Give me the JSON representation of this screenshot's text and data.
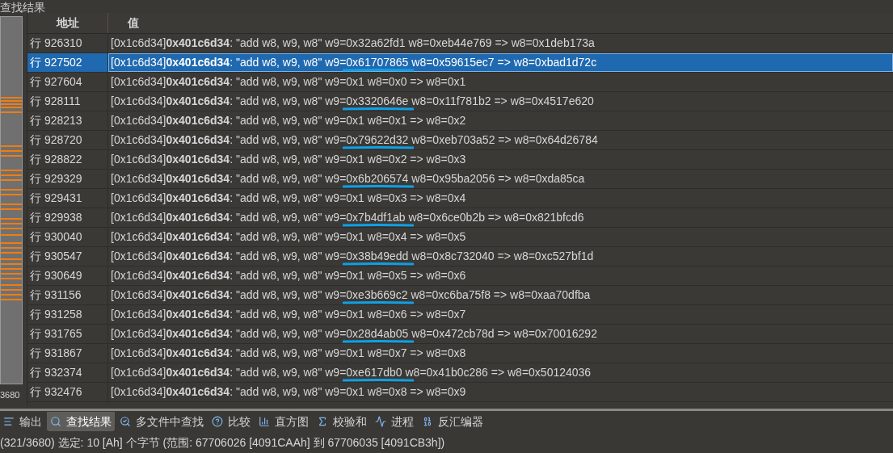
{
  "panel_title": "查找结果",
  "overview_label": "3680",
  "table": {
    "columns": [
      "地址",
      "值"
    ],
    "rows": [
      {
        "address": "行 926310",
        "value": "[0x1c6d34]**0x401c6d34**: \"add w8, w9, w8\" w9=0x32a62fd1 w8=0xeb44e769 => w8=0x1deb173a",
        "selected": false,
        "marked": false
      },
      {
        "address": "行 927502",
        "value": "[0x1c6d34]**0x401c6d34**: \"add w8, w9, w8\" w9=0x61707865 w8=0x59615ec7 => w8=0xbad1d72c",
        "selected": true,
        "marked": true
      },
      {
        "address": "行 927604",
        "value": "[0x1c6d34]**0x401c6d34**: \"add w8, w9, w8\" w9=0x1 w8=0x0 => w8=0x1",
        "selected": false,
        "marked": false
      },
      {
        "address": "行 928111",
        "value": "[0x1c6d34]**0x401c6d34**: \"add w8, w9, w8\" w9=0x3320646e w8=0x11f781b2 => w8=0x4517e620",
        "selected": false,
        "marked": true
      },
      {
        "address": "行 928213",
        "value": "[0x1c6d34]**0x401c6d34**: \"add w8, w9, w8\" w9=0x1 w8=0x1 => w8=0x2",
        "selected": false,
        "marked": false
      },
      {
        "address": "行 928720",
        "value": "[0x1c6d34]**0x401c6d34**: \"add w8, w9, w8\" w9=0x79622d32 w8=0xeb703a52 => w8=0x64d26784",
        "selected": false,
        "marked": true
      },
      {
        "address": "行 928822",
        "value": "[0x1c6d34]**0x401c6d34**: \"add w8, w9, w8\" w9=0x1 w8=0x2 => w8=0x3",
        "selected": false,
        "marked": false
      },
      {
        "address": "行 929329",
        "value": "[0x1c6d34]**0x401c6d34**: \"add w8, w9, w8\" w9=0x6b206574 w8=0x95ba2056 => w8=0xda85ca",
        "selected": false,
        "marked": true
      },
      {
        "address": "行 929431",
        "value": "[0x1c6d34]**0x401c6d34**: \"add w8, w9, w8\" w9=0x1 w8=0x3 => w8=0x4",
        "selected": false,
        "marked": false
      },
      {
        "address": "行 929938",
        "value": "[0x1c6d34]**0x401c6d34**: \"add w8, w9, w8\" w9=0x7b4df1ab w8=0x6ce0b2b => w8=0x821bfcd6",
        "selected": false,
        "marked": true
      },
      {
        "address": "行 930040",
        "value": "[0x1c6d34]**0x401c6d34**: \"add w8, w9, w8\" w9=0x1 w8=0x4 => w8=0x5",
        "selected": false,
        "marked": false
      },
      {
        "address": "行 930547",
        "value": "[0x1c6d34]**0x401c6d34**: \"add w8, w9, w8\" w9=0x38b49edd w8=0x8c732040 => w8=0xc527bf1d",
        "selected": false,
        "marked": true
      },
      {
        "address": "行 930649",
        "value": "[0x1c6d34]**0x401c6d34**: \"add w8, w9, w8\" w9=0x1 w8=0x5 => w8=0x6",
        "selected": false,
        "marked": false
      },
      {
        "address": "行 931156",
        "value": "[0x1c6d34]**0x401c6d34**: \"add w8, w9, w8\" w9=0xe3b669c2 w8=0xc6ba75f8 => w8=0xaa70dfba",
        "selected": false,
        "marked": true
      },
      {
        "address": "行 931258",
        "value": "[0x1c6d34]**0x401c6d34**: \"add w8, w9, w8\" w9=0x1 w8=0x6 => w8=0x7",
        "selected": false,
        "marked": false
      },
      {
        "address": "行 931765",
        "value": "[0x1c6d34]**0x401c6d34**: \"add w8, w9, w8\" w9=0x28d4ab05 w8=0x472cb78d => w8=0x70016292",
        "selected": false,
        "marked": true
      },
      {
        "address": "行 931867",
        "value": "[0x1c6d34]**0x401c6d34**: \"add w8, w9, w8\" w9=0x1 w8=0x7 => w8=0x8",
        "selected": false,
        "marked": false
      },
      {
        "address": "行 932374",
        "value": "[0x1c6d34]**0x401c6d34**: \"add w8, w9, w8\" w9=0xe617db0 w8=0x41b0c286 => w8=0x50124036",
        "selected": false,
        "marked": true
      },
      {
        "address": "行 932476",
        "value": "[0x1c6d34]**0x401c6d34**: \"add w8, w9, w8\" w9=0x1 w8=0x8 => w8=0x9",
        "selected": false,
        "marked": false
      }
    ]
  },
  "tabs": [
    {
      "label": "输出",
      "kind": "output",
      "selected": false
    },
    {
      "label": "查找结果",
      "kind": "find",
      "selected": true
    },
    {
      "label": "多文件中查找",
      "kind": "multifind",
      "selected": false
    },
    {
      "label": "比较",
      "kind": "compare",
      "selected": false
    },
    {
      "label": "直方图",
      "kind": "histogram",
      "selected": false
    },
    {
      "label": "校验和",
      "kind": "checksum",
      "selected": false
    },
    {
      "label": "进程",
      "kind": "process",
      "selected": false
    },
    {
      "label": "反汇编器",
      "kind": "disasm",
      "selected": false
    }
  ],
  "status_bar": "(321/3680) 选定: 10 [Ah] 个字节 (范围: 67706026 [4091CAAh] 到 67706035 [4091CB3h])"
}
